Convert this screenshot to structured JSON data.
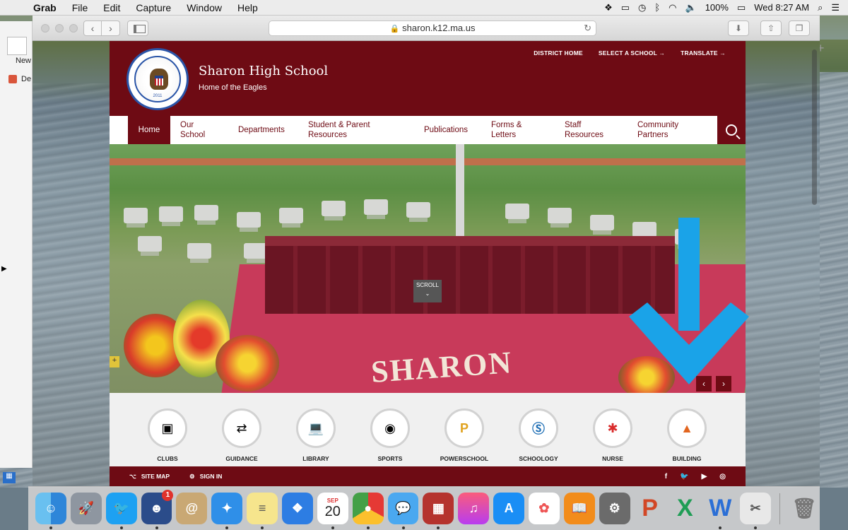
{
  "menubar": {
    "app": "Grab",
    "menus": [
      "File",
      "Edit",
      "Capture",
      "Window",
      "Help"
    ],
    "battery": "100%",
    "clock": "Wed 8:27 AM"
  },
  "finder": {
    "new_label": "New",
    "de_label": "De"
  },
  "browser": {
    "url": "sharon.k12.ma.us"
  },
  "site": {
    "school_name": "Sharon High School",
    "tagline": "Home of the Eagles",
    "seal_year": "2011",
    "toplinks": [
      "DISTRICT HOME",
      "SELECT A SCHOOL →",
      "TRANSLATE →"
    ],
    "nav": [
      {
        "label": "Home"
      },
      {
        "label": "Our\nSchool"
      },
      {
        "label": "Departments"
      },
      {
        "label": "Student & Parent\nResources"
      },
      {
        "label": "Publications"
      },
      {
        "label": "Forms &\nLetters"
      },
      {
        "label": "Staff\nResources"
      },
      {
        "label": "Community\nPartners"
      }
    ],
    "hero_text": "SHARON",
    "scroll_label": "SCROLL",
    "quicklinks": [
      "CLUBS",
      "GUIDANCE",
      "LIBRARY",
      "SPORTS",
      "POWERSCHOOL",
      "SCHOOLOGY",
      "NURSE",
      "BUILDING"
    ],
    "footer": {
      "site_map": "SITE MAP",
      "sign_in": "SIGN IN"
    }
  },
  "dock": {
    "calendar_month": "SEP",
    "calendar_day": "20",
    "badge_count": "1"
  },
  "colors": {
    "maroon": "#6e0b14",
    "blue_arrow": "#1aa3e8"
  }
}
